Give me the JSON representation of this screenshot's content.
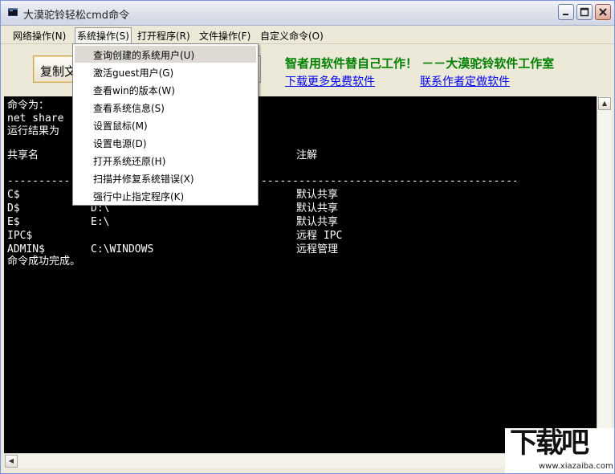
{
  "window": {
    "title": "大漠驼铃轻松cmd命令",
    "icon": "console-app-icon"
  },
  "menubar": [
    {
      "label": "网络操作(N)"
    },
    {
      "label": "系统操作(S)"
    },
    {
      "label": "打开程序(R)"
    },
    {
      "label": "文件操作(F)"
    },
    {
      "label": "自定义命令(O)"
    }
  ],
  "dropdown": {
    "items": [
      {
        "label": "查询创建的系统用户(U)",
        "highlighted": true
      },
      {
        "label": "激活guest用户(G)"
      },
      {
        "label": "查看win的版本(W)"
      },
      {
        "label": "查看系统信息(S)"
      },
      {
        "label": "设置鼠标(M)"
      },
      {
        "label": "设置电源(D)"
      },
      {
        "label": "打开系统还原(H)"
      },
      {
        "label": "扫描并修复系统错误(X)"
      },
      {
        "label": "强行中止指定程序(K)"
      }
    ]
  },
  "panel": {
    "copy_button": "复制文",
    "slogan": "智者用软件替自己工作！ －－大漠驼铃软件工作室",
    "link_download": "下载更多免费软件",
    "link_contact": "联系作者定做软件"
  },
  "console": {
    "line_cmd_label": "命令为：",
    "line_cmd": "net share",
    "line_result_label": "运行结果为",
    "header_share": "共享名",
    "header_note": "注解",
    "separator_left": "----------",
    "separator_right": "-------------------------------------------------------------------",
    "rows": [
      {
        "share": "C$",
        "path": "",
        "note": "默认共享"
      },
      {
        "share": "D$",
        "path": "D:\\",
        "note": "默认共享"
      },
      {
        "share": "E$",
        "path": "E:\\",
        "note": "默认共享"
      },
      {
        "share": "IPC$",
        "path": "",
        "note": "远程 IPC"
      },
      {
        "share": "ADMIN$",
        "path": "C:\\WINDOWS",
        "note": "远程管理"
      }
    ],
    "done": "命令成功完成。"
  },
  "watermark": {
    "big": "下载吧",
    "small": "www.xiazaiba.com"
  },
  "colors": {
    "slogan": "#008000",
    "link": "#0000ee",
    "console_bg": "#000000",
    "console_fg": "#ffffff"
  }
}
